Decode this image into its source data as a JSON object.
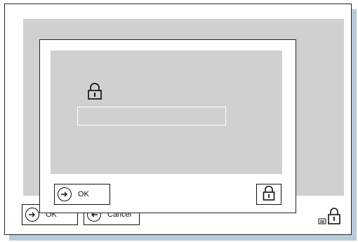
{
  "background_dialog": {
    "ok_label": "OK",
    "cancel_label": "Cancel"
  },
  "password_dialog": {
    "password_value": "",
    "ok_label": "OK"
  },
  "icons": {
    "lock": "lock-icon",
    "keyboard": "keyboard-icon",
    "arrow": "arrow-right-icon",
    "cancel": "cancel-arrow-icon"
  },
  "colors": {
    "panel_grey": "#d0d0d0",
    "shadow": "#b9cbd9",
    "border": "#222222"
  }
}
